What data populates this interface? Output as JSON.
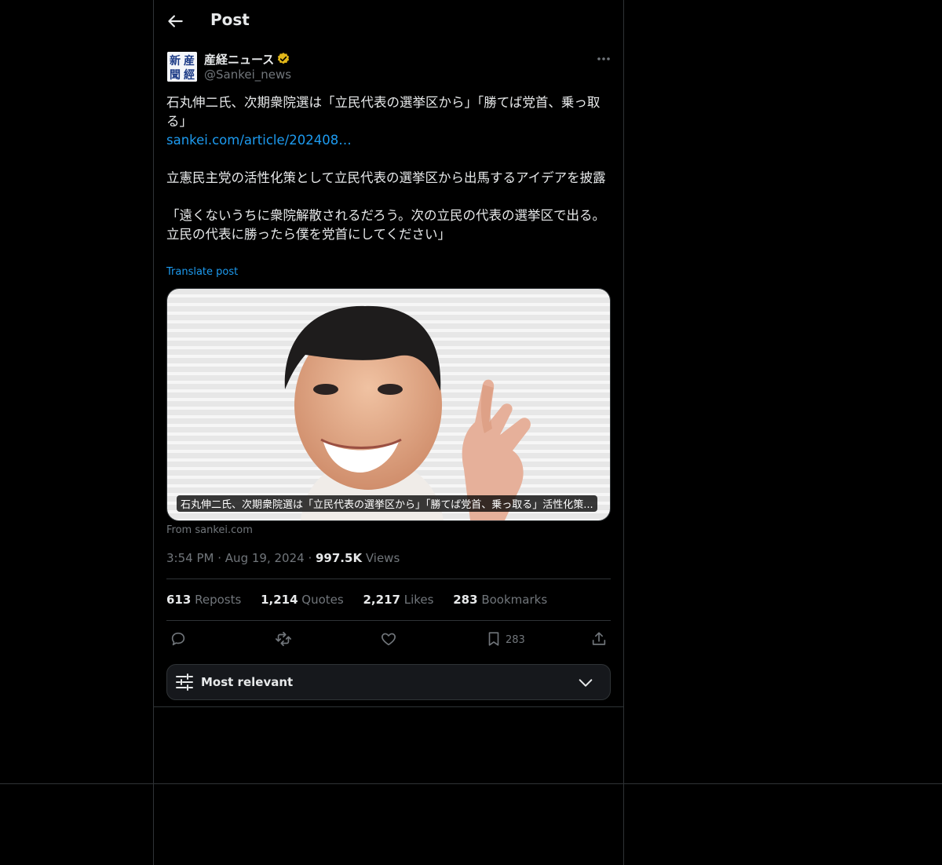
{
  "header": {
    "title": "Post"
  },
  "author": {
    "name": "産経ニュース",
    "handle": "@Sankei_news",
    "avatar_chars": [
      "産",
      "經",
      "新",
      "聞"
    ]
  },
  "post": {
    "line1": "石丸伸二氏、次期衆院選は「立民代表の選挙区から」「勝てば党首、乗っ取る」",
    "link": "sankei.com/article/202408…",
    "para2": "立憲民主党の活性化策として立民代表の選挙区から出馬するアイデアを披露",
    "para3": "「遠くないうちに衆院解散されるだろう。次の立民の代表の選挙区で出る。立民の代表に勝ったら僕を党首にしてください」",
    "translate": "Translate post"
  },
  "card": {
    "caption": "石丸伸二氏、次期衆院選は「立民代表の選挙区から」「勝てば党首、乗っ取る」活性化策...",
    "from": "From sankei.com"
  },
  "meta": {
    "time": "3:54 PM",
    "dot": "·",
    "date": "Aug 19, 2024",
    "views": "997.5K",
    "views_label": "Views"
  },
  "stats": [
    {
      "num": "613",
      "label": "Reposts"
    },
    {
      "num": "1,214",
      "label": "Quotes"
    },
    {
      "num": "2,217",
      "label": "Likes"
    },
    {
      "num": "283",
      "label": "Bookmarks"
    }
  ],
  "actions": {
    "icons": [
      "reply-icon",
      "repost-icon",
      "like-icon",
      "bookmark-icon",
      "share-icon"
    ],
    "bookmark_count": "283"
  },
  "sort": {
    "label": "Most relevant"
  },
  "colors": {
    "background": "#000000",
    "border": "#2f3336",
    "text": "#e7e9ea",
    "muted": "#71767b",
    "link": "#1d9bf0",
    "verified": "#e2b719"
  }
}
